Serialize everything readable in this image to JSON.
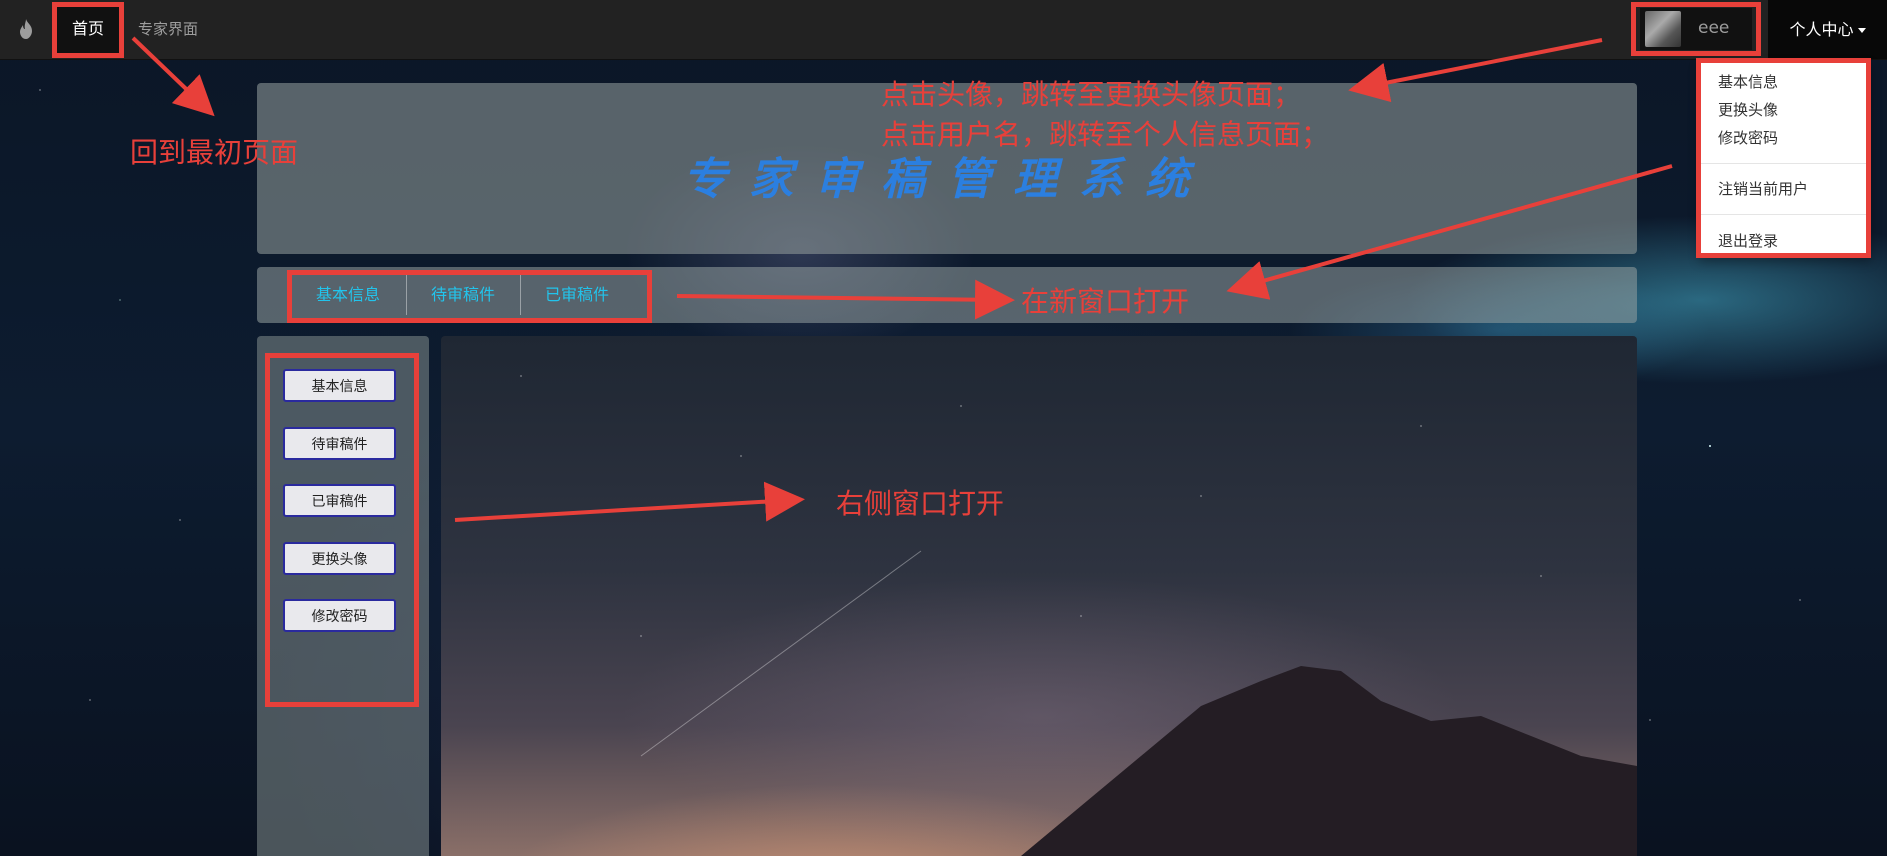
{
  "navbar": {
    "brand_icon": "flame-icon",
    "home": "首页",
    "expert": "专家界面",
    "username": "eee",
    "personal_center": "个人中心"
  },
  "dropdown": {
    "items": [
      "基本信息",
      "更换头像",
      "修改密码",
      "注销当前用户",
      "退出登录"
    ]
  },
  "banner": {
    "title": "专家审稿管理系统"
  },
  "tabs": [
    "基本信息",
    "待审稿件",
    "已审稿件"
  ],
  "sidebar": {
    "buttons": [
      "基本信息",
      "待审稿件",
      "已审稿件",
      "更换头像",
      "修改密码"
    ]
  },
  "annotations": {
    "home": "回到最初页面",
    "avatar_line1": "点击头像，跳转至更换头像页面；",
    "avatar_line2": "点击用户名，跳转至个人信息页面；",
    "new_window": "在新窗口打开",
    "right_window": "右侧窗口打开"
  },
  "colors": {
    "annotation": "#e8403a",
    "tab_text": "#22c4ec",
    "title": "#2b7fe0",
    "navbar": "#222222"
  }
}
